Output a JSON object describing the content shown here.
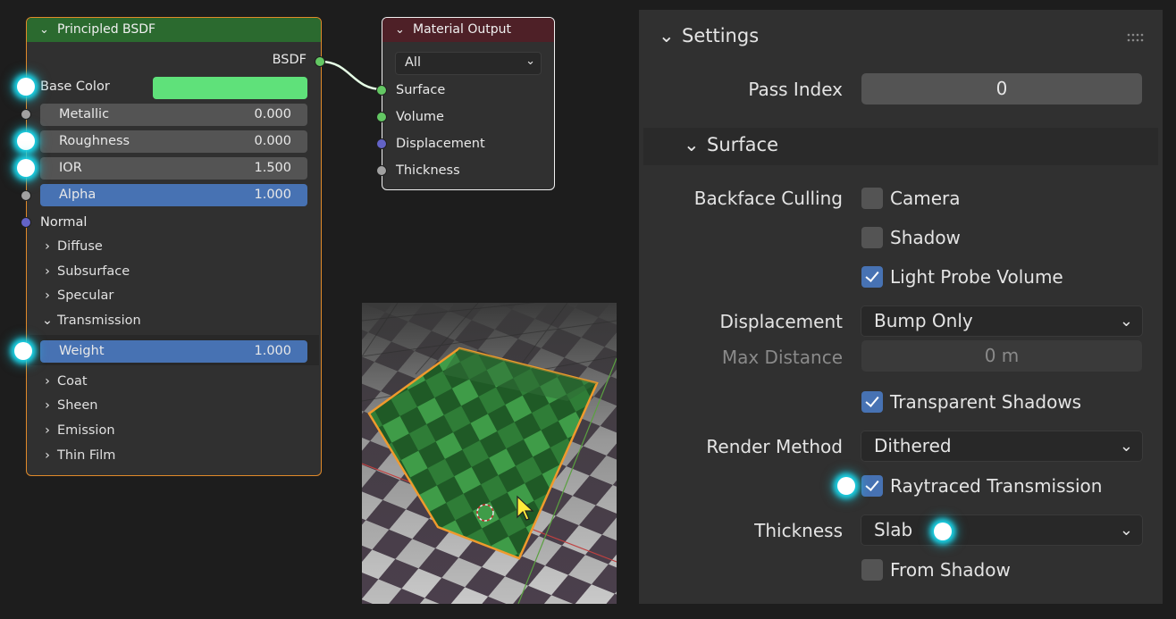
{
  "bsdf_node": {
    "title": "Principled BSDF",
    "output_label": "BSDF",
    "base_color_label": "Base Color",
    "base_color_value": "#5fe17a",
    "metallic": {
      "label": "Metallic",
      "value": "0.000"
    },
    "roughness": {
      "label": "Roughness",
      "value": "0.000"
    },
    "ior": {
      "label": "IOR",
      "value": "1.500"
    },
    "alpha": {
      "label": "Alpha",
      "value": "1.000"
    },
    "normal_label": "Normal",
    "panels": [
      "Diffuse",
      "Subsurface",
      "Specular",
      "Transmission",
      "Coat",
      "Sheen",
      "Emission",
      "Thin Film"
    ],
    "transmission_weight": {
      "label": "Weight",
      "value": "1.000"
    }
  },
  "output_node": {
    "title": "Material Output",
    "target": "All",
    "inputs": [
      "Surface",
      "Volume",
      "Displacement",
      "Thickness"
    ]
  },
  "properties": {
    "settings_header": "Settings",
    "pass_index_label": "Pass Index",
    "pass_index_value": "0",
    "surface_header": "Surface",
    "backface_culling_label": "Backface Culling",
    "camera_label": "Camera",
    "camera_checked": false,
    "shadow_label": "Shadow",
    "shadow_checked": false,
    "light_probe_label": "Light Probe Volume",
    "light_probe_checked": true,
    "displacement_label": "Displacement",
    "displacement_value": "Bump Only",
    "max_distance_label": "Max Distance",
    "max_distance_value": "0 m",
    "transparent_shadows_label": "Transparent Shadows",
    "transparent_shadows_checked": true,
    "render_method_label": "Render Method",
    "render_method_value": "Dithered",
    "raytraced_label": "Raytraced Transmission",
    "raytraced_checked": true,
    "thickness_label": "Thickness",
    "thickness_value": "Slab",
    "from_shadow_label": "From Shadow",
    "from_shadow_checked": false
  },
  "colors": {
    "highlight_glow": "#1ad4e8",
    "selection_outline": "#e08a2a",
    "accent_blue": "#4772b3"
  }
}
